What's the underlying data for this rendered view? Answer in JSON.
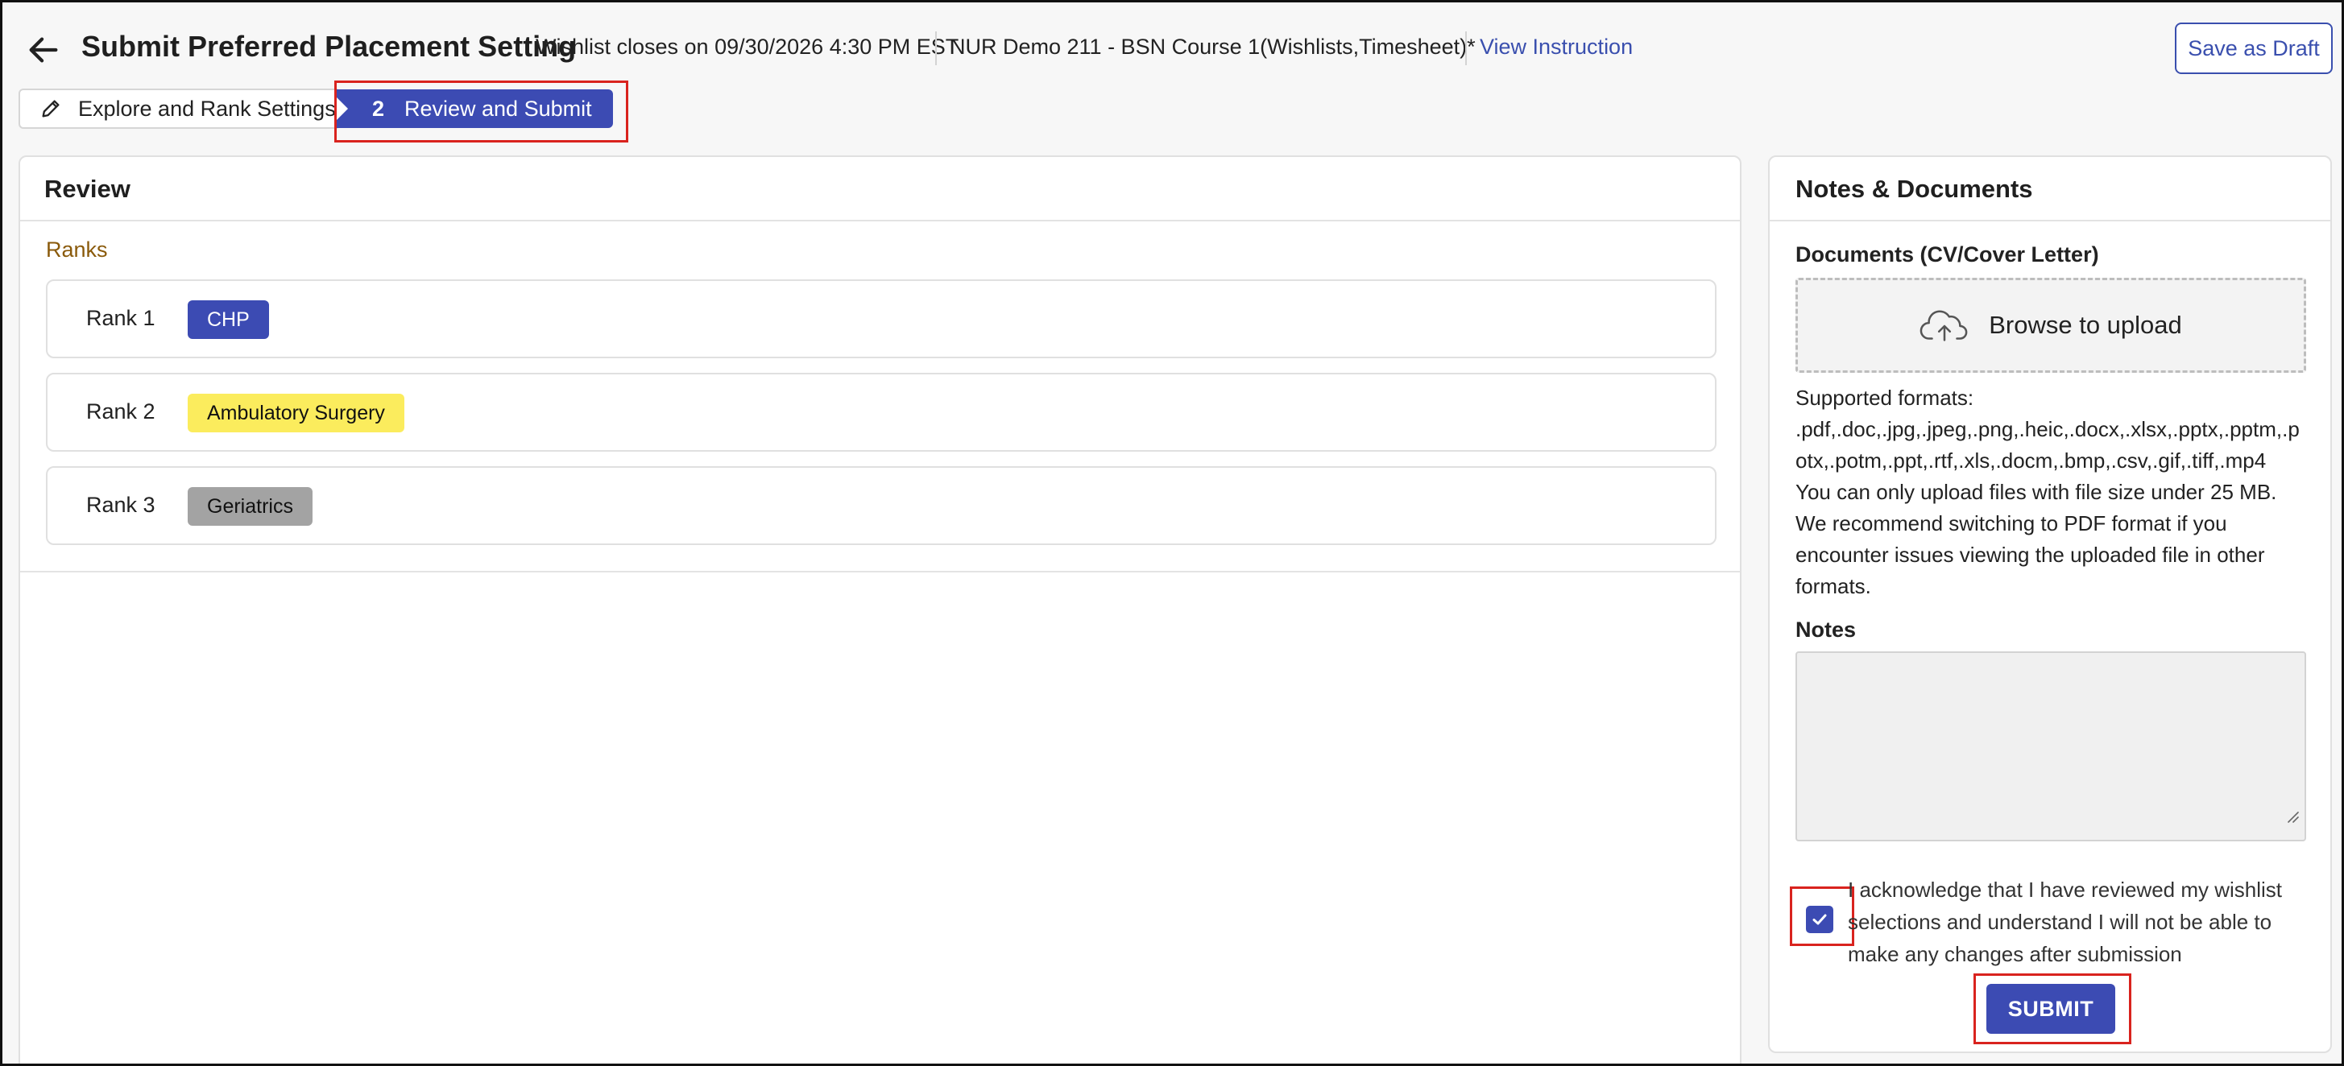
{
  "header": {
    "title": "Submit Preferred Placement Setting",
    "wishlist_close": "Wishlist closes on 09/30/2026 4:30 PM EST",
    "course": "NUR Demo 211 - BSN Course 1(Wishlists,Timesheet)*",
    "view_instruction": "View Instruction",
    "save_draft": "Save as Draft"
  },
  "steps": {
    "step1_label": "Explore and Rank Settings",
    "step2_number": "2",
    "step2_label": "Review and Submit"
  },
  "review": {
    "title": "Review",
    "ranks_label": "Ranks",
    "ranks": [
      {
        "label": "Rank 1",
        "chip": "CHP",
        "chip_color": "#3c4bb3",
        "chip_text_color": "#ffffff"
      },
      {
        "label": "Rank 2",
        "chip": "Ambulatory Surgery",
        "chip_color": "#fbec5d",
        "chip_text_color": "#111111"
      },
      {
        "label": "Rank 3",
        "chip": "Geriatrics",
        "chip_color": "#a3a3a3",
        "chip_text_color": "#111111"
      }
    ]
  },
  "notes_panel": {
    "title": "Notes & Documents",
    "documents_label": "Documents (CV/Cover Letter)",
    "upload_label": "Browse to upload",
    "info_lines": [
      "Supported formats:",
      ".pdf,.doc,.jpg,.jpeg,.png,.heic,.docx,.xlsx,.pptx,.pptm,.p",
      "otx,.potm,.ppt,.rtf,.xls,.docm,.bmp,.csv,.gif,.tiff,.mp4",
      "You can only upload files with file size under 25 MB.",
      "We recommend switching to PDF format if you",
      "encounter issues viewing the uploaded file in other",
      "formats."
    ],
    "notes_label": "Notes",
    "notes_value": "",
    "acknowledge_lines": [
      "I acknowledge that I have reviewed my wishlist",
      "selections and understand I will not be able to",
      "make any changes after submission"
    ],
    "acknowledge_checked": true,
    "submit_label": "SUBMIT"
  },
  "colors": {
    "accent": "#3c4bb3",
    "link": "#3a4fae",
    "ranks_label": "#8a5a0b",
    "highlight": "#d9231e"
  }
}
